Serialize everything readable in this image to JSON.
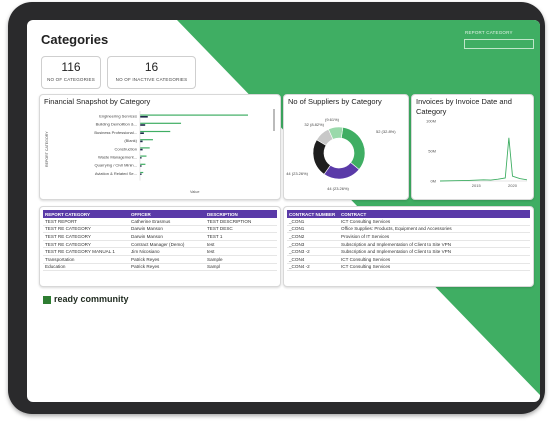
{
  "page": {
    "title": "Categories"
  },
  "stats": [
    {
      "value": "116",
      "label": "NO OF CATEGORIES"
    },
    {
      "value": "16",
      "label": "NO OF INACTIVE CATEGORIES"
    }
  ],
  "filter": {
    "label": "REPORT CATEGORY",
    "value": ""
  },
  "colors": {
    "accent_green": "#3fae63",
    "purple": "#5a3aa8",
    "dark": "#1e1e1e"
  },
  "financial": {
    "title": "Financial Snapshot by Category",
    "axis_label": "REPORT CATEGORY",
    "x_label": "Value"
  },
  "suppliers": {
    "title": "No of Suppliers by Category"
  },
  "invoices": {
    "title": "Invoices by Invoice Date and Category"
  },
  "chart_data": [
    {
      "type": "bar",
      "title": "Financial Snapshot by Category",
      "ylabel": "REPORT CATEGORY",
      "xlabel": "Value",
      "categories": [
        "Engineering Services",
        "Building Demolition &...",
        "Business Professional...",
        "(Blank)",
        "Construction",
        "Waste Management...",
        "Quarrying / Civil Minin...",
        "Aviation & Related Se..."
      ],
      "series": [
        {
          "values": [
            100,
            38,
            28,
            12,
            9,
            6,
            5,
            3
          ]
        },
        {
          "values": [
            6,
            4,
            3,
            2,
            2,
            1,
            1,
            1
          ]
        }
      ]
    },
    {
      "type": "pie",
      "title": "No of Suppliers by Category",
      "labels": [
        "52 (32.8%)",
        "44 (23.26%)",
        "44 (23.26%)",
        "32 (8.82%)",
        "(9.61%)"
      ],
      "values": [
        32.8,
        23.26,
        23.26,
        8.82,
        9.61
      ],
      "colors": [
        "#3fae63",
        "#5a3aa8",
        "#1e1e1e",
        "#9ad9ab",
        "#c8c8c8"
      ]
    },
    {
      "type": "line",
      "title": "Invoices by Invoice Date and Category",
      "y_ticks": [
        "100M",
        "50M",
        "0M"
      ],
      "x_ticks": [
        "2015",
        "2020"
      ],
      "ylim": [
        0,
        100
      ],
      "x": [
        2010,
        2012,
        2014,
        2016,
        2017,
        2018,
        2019,
        2019.5,
        2020,
        2021,
        2022
      ],
      "values": [
        0,
        0.5,
        1,
        2,
        1.5,
        3,
        5,
        72,
        8,
        4,
        2
      ]
    }
  ],
  "report_table": {
    "columns": [
      "REPORT CATEGORY",
      "OFFICER",
      "DESCRIPTION"
    ],
    "rows": [
      [
        "TEST REPORT",
        "Catherine Erasmus",
        "TEST DESCRIPTION"
      ],
      [
        "TEST RE CATEGORY",
        "Darwin Manson",
        "TEST DESC"
      ],
      [
        "TEST RE CATEGORY",
        "Darwin Manson",
        "TEST 1"
      ],
      [
        "TEST RE CATEGORY",
        "Contract Manager (Demo)",
        "test"
      ],
      [
        "TEST RE CATEGORY MANUAL 1",
        "Jim Nicosiano",
        "test"
      ],
      [
        "Transportation",
        "Patrick Reyes",
        "Sample"
      ],
      [
        "Education",
        "Patrick Reyes",
        "Sampl"
      ]
    ]
  },
  "contract_table": {
    "columns": [
      "CONTRACT NUMBER",
      "CONTRACT"
    ],
    "rows": [
      [
        "_CON1",
        "ICT Consulting Services"
      ],
      [
        "_CON1",
        "Office Supplies: Products, Equipment and Accessories"
      ],
      [
        "_CON2",
        "Provision of IT Services"
      ],
      [
        "_CON3",
        "Subscription and Implementation of Client to Site VPN"
      ],
      [
        "_CON3 -2",
        "Subscription and Implementation of Client to Site VPN"
      ],
      [
        "_CON4",
        "ICT Consulting Services"
      ],
      [
        "_CON4 -2",
        "ICT Consulting Services"
      ]
    ]
  },
  "brand": {
    "text": "ready community"
  }
}
